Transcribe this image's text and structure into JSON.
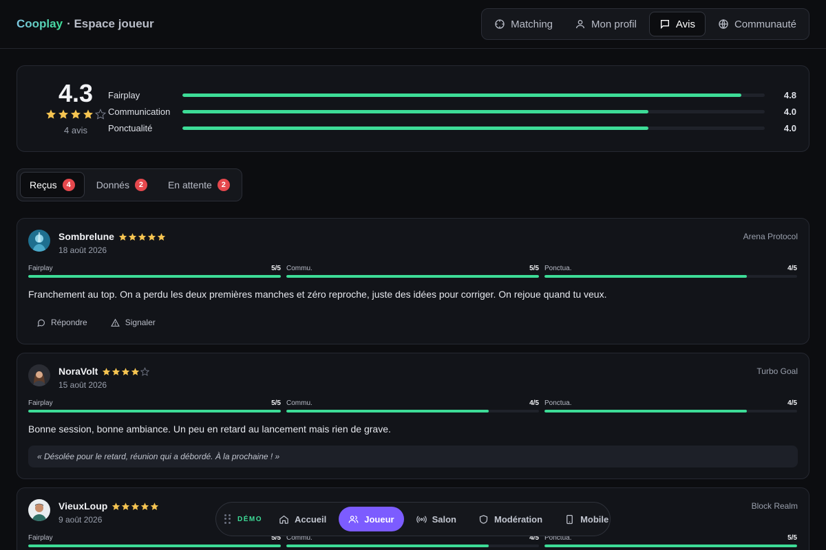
{
  "header": {
    "brand": "Cooplay",
    "subtitle": "· Espace joueur",
    "nav": [
      {
        "label": "Matching",
        "icon": "crosshair-icon",
        "active": false
      },
      {
        "label": "Mon profil",
        "icon": "user-icon",
        "active": false
      },
      {
        "label": "Avis",
        "icon": "message-icon",
        "active": true
      },
      {
        "label": "Communauté",
        "icon": "globe-icon",
        "active": false
      }
    ]
  },
  "summary": {
    "score": "4.3",
    "rating_fraction": 0.86,
    "count": "4 avis",
    "criteria": [
      {
        "label": "Fairplay",
        "value": "4.8",
        "fraction": 0.96
      },
      {
        "label": "Communication",
        "value": "4.0",
        "fraction": 0.8
      },
      {
        "label": "Ponctualité",
        "value": "4.0",
        "fraction": 0.8
      }
    ]
  },
  "tabs": [
    {
      "label": "Reçus",
      "count": "4",
      "active": true
    },
    {
      "label": "Donnés",
      "count": "2",
      "active": false
    },
    {
      "label": "En attente",
      "count": "2",
      "active": false
    }
  ],
  "reviews": [
    {
      "author": "Sombrelune",
      "stars": 5,
      "date": "18 août 2026",
      "game": "Arena Protocol",
      "criteria": [
        {
          "label": "Fairplay",
          "value": "5/5",
          "fraction": 1.0
        },
        {
          "label": "Commu.",
          "value": "5/5",
          "fraction": 1.0
        },
        {
          "label": "Ponctua.",
          "value": "4/5",
          "fraction": 0.8
        }
      ],
      "comment": "Franchement au top. On a perdu les deux premières manches et zéro reproche, juste des idées pour corriger. On rejoue quand tu veux.",
      "actions": {
        "reply": "Répondre",
        "report": "Signaler"
      }
    },
    {
      "author": "NoraVolt",
      "stars": 4,
      "date": "15 août 2026",
      "game": "Turbo Goal",
      "criteria": [
        {
          "label": "Fairplay",
          "value": "5/5",
          "fraction": 1.0
        },
        {
          "label": "Commu.",
          "value": "4/5",
          "fraction": 0.8
        },
        {
          "label": "Ponctua.",
          "value": "4/5",
          "fraction": 0.8
        }
      ],
      "comment": "Bonne session, bonne ambiance. Un peu en retard au lancement mais rien de grave.",
      "reply": "« Désolée pour le retard, réunion qui a débordé. À la prochaine ! »"
    },
    {
      "author": "VieuxLoup",
      "stars": 5,
      "date": "9 août 2026",
      "game": "Block Realm",
      "criteria": [
        {
          "label": "Fairplay",
          "value": "5/5",
          "fraction": 1.0
        },
        {
          "label": "Commu.",
          "value": "4/5",
          "fraction": 0.8
        },
        {
          "label": "Ponctua.",
          "value": "5/5",
          "fraction": 1.0
        }
      ]
    }
  ],
  "demo_bar": {
    "label": "DÉMO",
    "items": [
      {
        "label": "Accueil",
        "icon": "home-icon",
        "active": false
      },
      {
        "label": "Joueur",
        "icon": "users-icon",
        "active": true
      },
      {
        "label": "Salon",
        "icon": "broadcast-icon",
        "active": false
      },
      {
        "label": "Modération",
        "icon": "shield-icon",
        "active": false
      },
      {
        "label": "Mobile",
        "icon": "phone-icon",
        "active": false
      }
    ]
  },
  "colors": {
    "accent": "#3ddc97",
    "star": "#f5c451",
    "badge": "#e5484d",
    "demo_active": "#7c5cff"
  }
}
